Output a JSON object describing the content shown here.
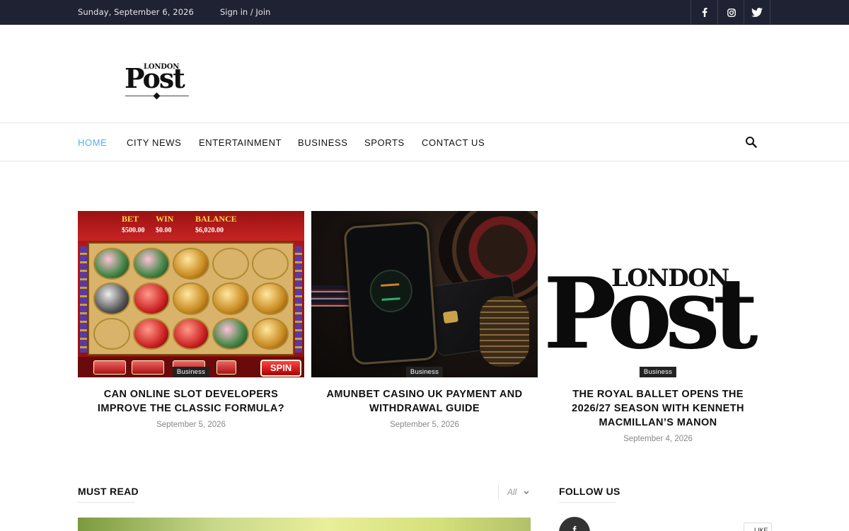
{
  "topbar": {
    "date": "Sunday, September 6, 2026",
    "signin": "Sign in / Join",
    "social": [
      "facebook-icon",
      "instagram-icon",
      "twitter-icon"
    ]
  },
  "logo": {
    "small": "LONDON",
    "big": "Post"
  },
  "nav": {
    "items": [
      "HOME",
      "CITY NEWS",
      "ENTERTAINMENT",
      "BUSINESS",
      "SPORTS",
      "CONTACT US"
    ],
    "active": "HOME",
    "search_icon": "search-icon"
  },
  "colors": {
    "topbar_bg": "#1f2233",
    "accent": "#4db2ec",
    "tag_bg": "#222222"
  },
  "featured": [
    {
      "category": "Business",
      "title": "CAN ONLINE SLOT DEVELOPERS IMPROVE THE CLASSIC FORMULA?",
      "date": "September 5, 2026",
      "image": {
        "bet_label": "BET",
        "bet_value": "$500.00",
        "win_label": "WIN",
        "win_value": "$0.00",
        "balance_label": "BALANCE",
        "balance_value": "$6,020.00",
        "spin": "SPIN"
      }
    },
    {
      "category": "Business",
      "title": "AMUNBET CASINO UK PAYMENT AND WITHDRAWAL GUIDE",
      "date": "September 5, 2026"
    },
    {
      "category": "Business",
      "title": "THE ROYAL BALLET OPENS THE 2026/27 SEASON WITH KENNETH MACMILLAN’S MANON",
      "date": "September 4, 2026",
      "image": {
        "small": "LONDON",
        "big": "Post"
      }
    }
  ],
  "must_read": {
    "title": "MUST READ",
    "filter": "All"
  },
  "follow_us": {
    "title": "FOLLOW US",
    "fb_letter": "f",
    "like": "LIKE"
  }
}
